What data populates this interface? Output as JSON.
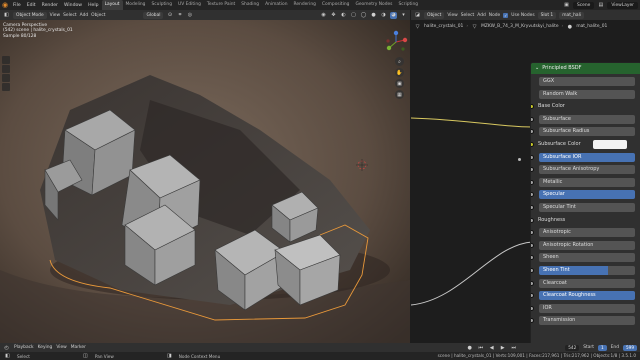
{
  "menubar": {
    "menus": [
      "File",
      "Edit",
      "Render",
      "Window",
      "Help"
    ],
    "workspaces": [
      "Layout",
      "Modeling",
      "Sculpting",
      "UV Editing",
      "Texture Paint",
      "Shading",
      "Animation",
      "Rendering",
      "Compositing",
      "Geometry Nodes",
      "Scripting"
    ],
    "active_workspace": "Layout",
    "scene": "Scene",
    "view_layer": "ViewLayer"
  },
  "viewport_header": {
    "mode": "Object Mode",
    "items": [
      "View",
      "Select",
      "Add",
      "Object"
    ],
    "transform": "Global"
  },
  "viewport": {
    "info_line1": "Camera Perspective",
    "info_line2": "(542) scene | halite_crystals_01",
    "info_line3": "Sample 80/128"
  },
  "node_header": {
    "editor_type": "Object",
    "items": [
      "View",
      "Select",
      "Add",
      "Node"
    ],
    "use_nodes_label": "Use Nodes",
    "slot": "Slot 1",
    "material": "mat_hali"
  },
  "node_breadcrumb": [
    "halite_crystals_01",
    "MZKW_B_74_3_M_Kryvutskyi_halite",
    "mat_halite_01"
  ],
  "node": {
    "title": "Principled BSDF",
    "rows": [
      {
        "label": "GGX",
        "kind": "field"
      },
      {
        "label": "Random Walk",
        "kind": "field"
      },
      {
        "label": "Base Color",
        "kind": "label"
      },
      {
        "label": "Subsurface",
        "kind": "field"
      },
      {
        "label": "Subsurface Radius",
        "kind": "field"
      },
      {
        "label": "Subsurface Color",
        "kind": "label"
      },
      {
        "label": "Subsurface IOR",
        "kind": "hl"
      },
      {
        "label": "Subsurface Anisotropy",
        "kind": "field"
      },
      {
        "label": "Metallic",
        "kind": "field"
      },
      {
        "label": "Specular",
        "kind": "hl"
      },
      {
        "label": "Specular Tint",
        "kind": "field"
      },
      {
        "label": "Roughness",
        "kind": "label"
      },
      {
        "label": "Anisotropic",
        "kind": "field"
      },
      {
        "label": "Anisotropic Rotation",
        "kind": "field"
      },
      {
        "label": "Sheen",
        "kind": "field"
      },
      {
        "label": "Sheen Tint",
        "kind": "half"
      },
      {
        "label": "Clearcoat",
        "kind": "field"
      },
      {
        "label": "Clearcoat Roughness",
        "kind": "hl"
      },
      {
        "label": "IOR",
        "kind": "field"
      },
      {
        "label": "Transmission",
        "kind": "field"
      }
    ]
  },
  "timeline": {
    "items": [
      "Playback",
      "Keying",
      "View",
      "Marker"
    ],
    "current_frame": "542",
    "start_label": "Start",
    "start": "1",
    "end_label": "End",
    "end": "599"
  },
  "statusbar": {
    "items": [
      "Select",
      "Pan View",
      "Node Context Menu"
    ],
    "stats": "scene | halite_crystals_01 | Verts:109,001 | Faces:217,961 | Tris:217,962 | Objects:1/8 | 3.5.1.0"
  },
  "colors": {
    "accent_blue": "#4772b3",
    "node_header_green": "#26632e",
    "selection_outline": "#e8983a"
  }
}
